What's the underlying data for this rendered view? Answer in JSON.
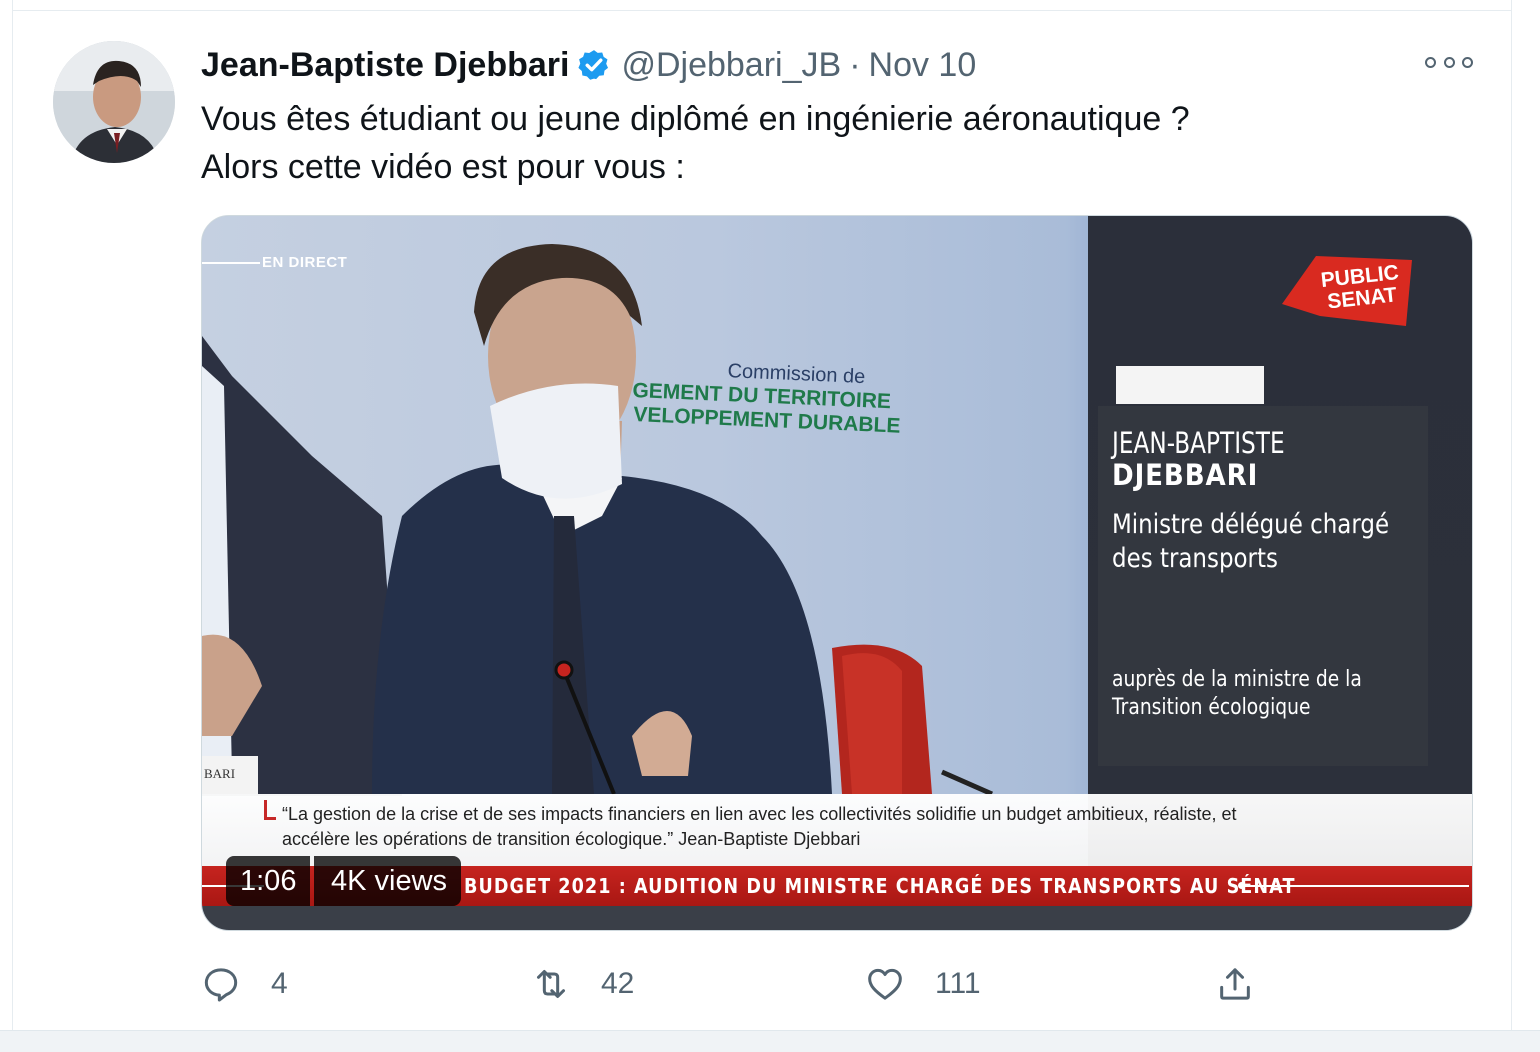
{
  "tweet": {
    "author_name": "Jean-Baptiste Djebbari",
    "handle": "@Djebbari_JB",
    "separator": "·",
    "date": "Nov 10",
    "text_lines": [
      "Vous êtes étudiant ou jeune diplômé en ingénierie aéronautique ?",
      "Alors cette vidéo est pour vous :"
    ]
  },
  "video": {
    "live_label": "EN DIRECT",
    "wall_line1": "Commission de",
    "wall_line2": "GEMENT DU TERRITOIRE",
    "wall_line3": "VELOPPEMENT DURABLE",
    "channel_logo_line1": "PUBLIC",
    "channel_logo_line2": "SENAT",
    "panel_name_first": "JEAN-BAPTISTE",
    "panel_name_last": "DJEBBARI",
    "panel_role_line1": "Ministre délégué chargé",
    "panel_role_line2": "des transports",
    "panel_sub_line1": "auprès de la ministre de la",
    "panel_sub_line2": "Transition écologique",
    "nameplate": "BARI",
    "quote_line1": "“La gestion de la crise et de ses impacts financiers en lien avec les collectivités solidifie un budget ambitieux, réaliste, et",
    "quote_line2": "accélère les opérations de transition écologique.” Jean-Baptiste Djebbari",
    "ticker": "BUDGET 2021 : AUDITION DU MINISTRE CHARGÉ DES TRANSPORTS AU SÉNAT",
    "duration": "1:06",
    "views": "4K views"
  },
  "actions": {
    "reply_icon": "reply-icon",
    "reply_count": "4",
    "retweet_icon": "retweet-icon",
    "retweet_count": "42",
    "like_icon": "heart-icon",
    "like_count": "111",
    "share_icon": "share-icon"
  },
  "colors": {
    "verified_blue": "#1d9bf0",
    "text_primary": "#0f1419",
    "text_secondary": "#536471",
    "ticker_red": "#c6241f"
  }
}
